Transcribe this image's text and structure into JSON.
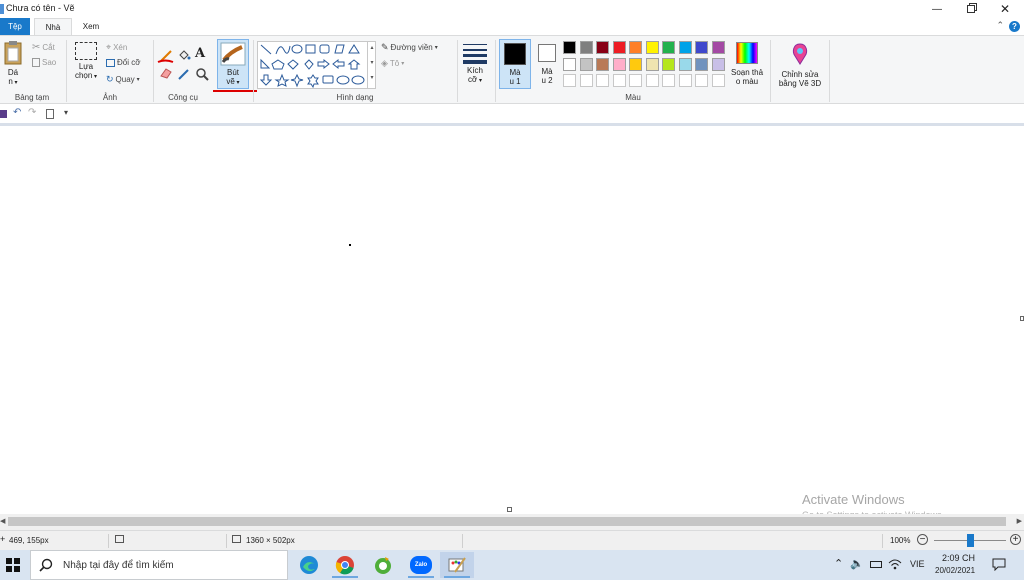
{
  "window": {
    "title": "Chưa có tên - Vẽ"
  },
  "tabs": {
    "file": "Tệp",
    "home": "Nhà",
    "view": "Xem"
  },
  "clipboard": {
    "paste_label_1": "Dá",
    "paste_label_2": "n",
    "cut": "Cắt",
    "copy": "Sao",
    "group_label": "Bảng tạm"
  },
  "image": {
    "select_label_1": "Lựa",
    "select_label_2": "chọn",
    "crop": "Xén",
    "resize": "Đổi cỡ",
    "rotate": "Quay",
    "group_label": "Ảnh"
  },
  "tools": {
    "group_label": "Công cụ"
  },
  "brushes": {
    "label_1": "Bút",
    "label_2": "vẽ"
  },
  "shapes": {
    "outline": "Đường viền",
    "fill": "Tô",
    "group_label": "Hình dạng"
  },
  "size": {
    "label_1": "Kích",
    "label_2": "cỡ"
  },
  "colors": {
    "color1_label_1": "Mà",
    "color1_label_2": "u 1",
    "color2_label_1": "Mà",
    "color2_label_2": "u 2",
    "edit_colors_1": "Soạn thả",
    "edit_colors_2": "o màu",
    "paint3d_1": "Chỉnh sửa",
    "paint3d_2": "bằng Vẽ 3D",
    "group_label": "Màu",
    "color1": "#000000",
    "color2": "#ffffff",
    "palette_row1": [
      "#000000",
      "#7f7f7f",
      "#880015",
      "#ed1c24",
      "#ff7f27",
      "#fff200",
      "#22b14c",
      "#00a2e8",
      "#3f48cc",
      "#a349a4"
    ],
    "palette_row2": [
      "#ffffff",
      "#c3c3c3",
      "#b97a57",
      "#ffaec9",
      "#ffc90e",
      "#efe4b0",
      "#b5e61d",
      "#99d9ea",
      "#7092be",
      "#c8bfe7"
    ],
    "palette_row3": [
      "#ffffff",
      "#ffffff",
      "#ffffff",
      "#ffffff",
      "#ffffff",
      "#ffffff",
      "#ffffff",
      "#ffffff",
      "#ffffff",
      "#ffffff"
    ]
  },
  "status": {
    "cursor_pos": "469, 155px",
    "canvas_size": "1360 × 502px",
    "zoom": "100%",
    "zoom_level": 0.5
  },
  "watermark": {
    "line1": "Activate Windows",
    "line2": "Go to Settings to activate Windows."
  },
  "taskbar": {
    "search_placeholder": "Nhập tại đây để tìm kiếm",
    "zalo_label": "Zalo",
    "language": "VIE",
    "time": "2:09 CH",
    "date": "20/02/2021"
  }
}
